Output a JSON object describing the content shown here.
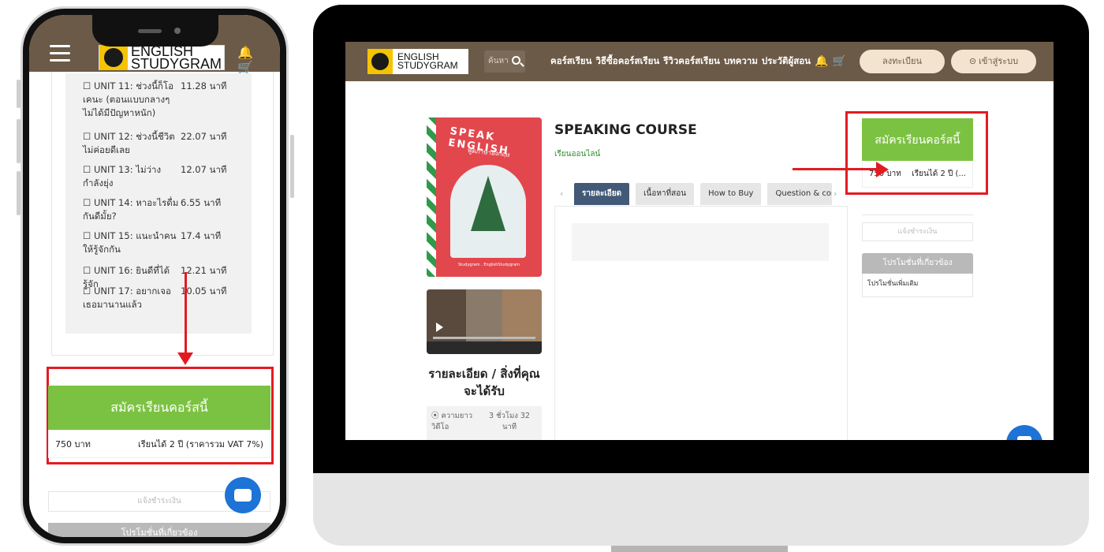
{
  "brand": {
    "line1": "ENGLISH",
    "line2": "STUDYGRAM"
  },
  "colors": {
    "header": "#6b5a47",
    "enroll_green": "#7cc242",
    "highlight_red": "#e21b23",
    "active_tab": "#425a78",
    "chat_blue": "#1e73d6"
  },
  "icons": {
    "menu": "hamburger-icon",
    "bell": "bell-icon",
    "cart": "cart-icon",
    "search": "search-icon",
    "login": "login-icon",
    "chat": "chat-icon"
  },
  "mobile": {
    "header_icons": "🔔 🛒",
    "units": [
      {
        "title": "☐ UNIT 11: ช่วงนี้ก็โอเคนะ (ตอนแบบกลางๆ ไม่ได้มีปัญหาหนัก)",
        "duration": "11.28 นาที"
      },
      {
        "title": "☐ UNIT 12: ช่วงนี้ชีวิตไม่ค่อยดีเลย",
        "duration": "22.07 นาที"
      },
      {
        "title": "☐ UNIT 13: ไม่ว่างกำลังยุ่ง",
        "duration": "12.07 นาที"
      },
      {
        "title": "☐ UNIT 14: หาอะไรดื่มกันดีมั้ย?",
        "duration": "6.55 นาที"
      },
      {
        "title": "☐ UNIT 15: แนะนำคนให้รู้จักกัน",
        "duration": "17.4 นาที"
      },
      {
        "title": "☐ UNIT 16: ยินดีที่ได้รู้จัก",
        "duration": "12.21 นาที"
      },
      {
        "title": "☐ UNIT 17: อยากเจอเธอมานานแล้ว",
        "duration": "10.05 นาที"
      }
    ],
    "enroll_label": "สมัครเรียนคอร์สนี้",
    "price": "750 บาท",
    "access": "เรียนได้ 2 ปี (ราคารวม VAT 7%)",
    "pay_placeholder": "แจ้งชำระเงิน",
    "promo_label": "โปรโมชั่นที่เกี่ยวข้อง"
  },
  "desktop": {
    "search_placeholder": "ค้นหา",
    "nav": [
      "คอร์สเรียน",
      "วิธีซื้อคอร์สเรียน",
      "รีวิวคอร์สเรียน",
      "บทความ",
      "ประวัติผู้สอน"
    ],
    "register_label": "ลงทะเบียน",
    "login_label": "⊝ เข้าสู่ระบบ",
    "book": {
      "title": "SPEAK ENGLISH",
      "subtitle": "พูดภาษาอังกฤษ",
      "footer": "Studygram . EnglishStudygram"
    },
    "course_title": "SPEAKING COURSE",
    "course_mode": "เรียนออนไลน์",
    "tabs": [
      "รายละเอียด",
      "เนื้อหาที่สอน",
      "How to Buy",
      "Question & com"
    ],
    "active_tab": 0,
    "side_heading": "รายละเอียด / สิ่งที่คุณจะได้รับ",
    "meta_key": "⦿ ความยาววิดีโอ",
    "meta_value": "3 ชั่วโมง 32 นาที",
    "enroll_label": "สมัครเรียนคอร์สนี้",
    "price": "750 บาท",
    "access": "เรียนได้ 2 ปี (...",
    "pay_placeholder": "แจ้งชำระเงิน",
    "promo_label": "โปรโมชั่นที่เกี่ยวข้อง",
    "promo_item": "โปรโมชั่นเพิ่มเติม"
  }
}
